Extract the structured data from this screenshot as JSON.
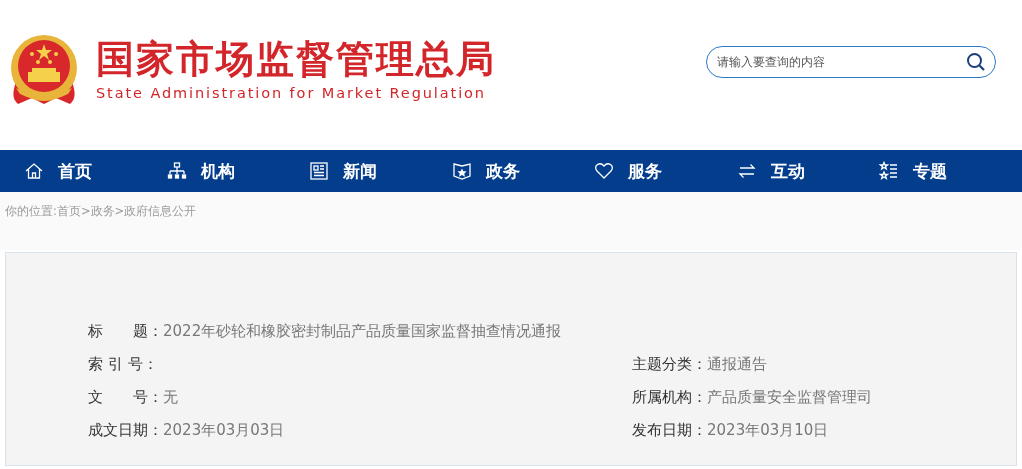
{
  "header": {
    "title": "国家市场监督管理总局",
    "subtitle": "State Administration for Market Regulation",
    "search": {
      "placeholder": "请输入要查询的内容"
    }
  },
  "nav": [
    {
      "label": "首页",
      "kind": "home"
    },
    {
      "label": "机构",
      "kind": "org"
    },
    {
      "label": "新闻",
      "kind": "news"
    },
    {
      "label": "政务",
      "kind": "affairs"
    },
    {
      "label": "服务",
      "kind": "service"
    },
    {
      "label": "互动",
      "kind": "interact"
    },
    {
      "label": "专题",
      "kind": "topic"
    }
  ],
  "breadcrumb": {
    "prefix": "你的位置:",
    "items": [
      "首页",
      "政务",
      "政府信息公开"
    ],
    "separator": ">"
  },
  "info": {
    "title": {
      "label": "标　　题：",
      "value": "2022年砂轮和橡胶密封制品产品质量国家监督抽查情况通报"
    },
    "rows": [
      [
        {
          "label": "索 引 号："
        },
        {
          "label": "主题分类：",
          "value": "通报通告"
        }
      ],
      [
        {
          "label": "文　　号：",
          "value": "无"
        },
        {
          "label": "所属机构：",
          "value": "产品质量安全监督管理司"
        }
      ],
      [
        {
          "label": "成文日期：",
          "value": "2023年03月03日"
        },
        {
          "label": "发布日期：",
          "value": "2023年03月10日"
        }
      ]
    ]
  }
}
